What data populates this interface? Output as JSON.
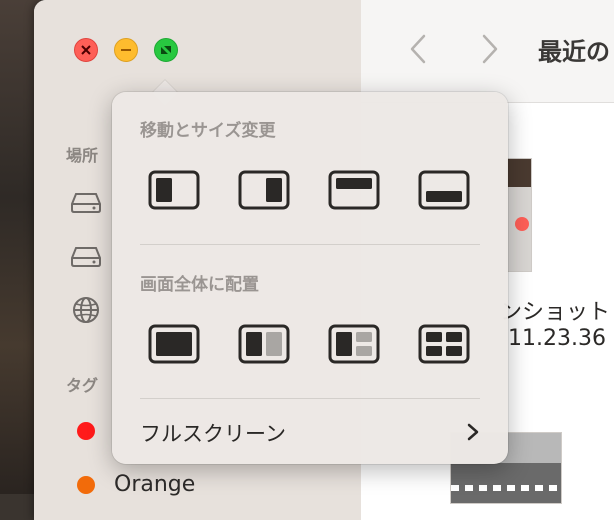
{
  "window": {
    "title": "最近の"
  },
  "sidebar": {
    "locations_header": "場所",
    "tags_header": "タグ",
    "location_items": [
      {
        "icon": "drive-icon"
      },
      {
        "icon": "drive-icon"
      },
      {
        "icon": "network-globe-icon"
      }
    ],
    "tags": [
      {
        "label": "",
        "color": "#ff1a1a"
      },
      {
        "label": "Orange",
        "color": "#f26b0a"
      }
    ]
  },
  "content": {
    "file_name_line1": "ンショット",
    "file_name_line2": "11.23.36"
  },
  "popover": {
    "move_resize_header": "移動とサイズ変更",
    "fullscreen_tile_header": "画面全体に配置",
    "fullscreen_label": "フルスクリーン",
    "move_resize_options": [
      "tile-left",
      "tile-right",
      "tile-top",
      "tile-bottom"
    ],
    "fullscreen_tile_options": [
      "fill",
      "split-left-right",
      "left-and-two-right",
      "quarters"
    ]
  },
  "colors": {
    "close": "#fe5f57",
    "minimize": "#febc2e",
    "zoom": "#28c840"
  }
}
